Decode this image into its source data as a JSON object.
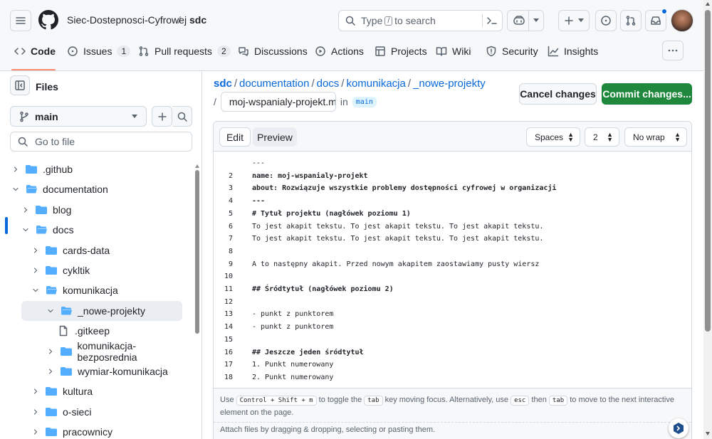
{
  "header": {
    "org": "Siec-Dostepnosci-Cyfrowej",
    "slash": "/",
    "repo": "sdc",
    "search_prefix": "Type",
    "search_key": "/",
    "search_suffix": "to search",
    "notification_dot_color": "#0969da"
  },
  "tabs": [
    {
      "label": "Code",
      "icon": "code-icon"
    },
    {
      "label": "Issues",
      "count": "1",
      "icon": "issue-icon"
    },
    {
      "label": "Pull requests",
      "count": "2",
      "icon": "pull-request-icon"
    },
    {
      "label": "Discussions",
      "icon": "discussion-icon"
    },
    {
      "label": "Actions",
      "icon": "play-icon"
    },
    {
      "label": "Projects",
      "icon": "table-icon"
    },
    {
      "label": "Wiki",
      "icon": "book-icon"
    },
    {
      "label": "Security",
      "icon": "shield-icon"
    },
    {
      "label": "Insights",
      "icon": "graph-icon"
    }
  ],
  "sidebar": {
    "title": "Files",
    "branch": "main",
    "go_to_file_placeholder": "Go to file",
    "tree": [
      {
        "name": ".github",
        "type": "folder",
        "expanded": false,
        "depth": 0
      },
      {
        "name": "documentation",
        "type": "folder",
        "expanded": true,
        "depth": 0
      },
      {
        "name": "blog",
        "type": "folder",
        "expanded": false,
        "depth": 1
      },
      {
        "name": "docs",
        "type": "folder",
        "expanded": true,
        "depth": 1
      },
      {
        "name": "cards-data",
        "type": "folder",
        "expanded": false,
        "depth": 2
      },
      {
        "name": "cykltik",
        "type": "folder",
        "expanded": false,
        "depth": 2
      },
      {
        "name": "komunikacja",
        "type": "folder",
        "expanded": true,
        "depth": 2
      },
      {
        "name": "_nowe-projekty",
        "type": "folder",
        "expanded": true,
        "depth": 3,
        "selected": true
      },
      {
        "name": ".gitkeep",
        "type": "file",
        "depth": 4
      },
      {
        "name": "komunikacja-bezposrednia",
        "type": "folder",
        "expanded": false,
        "depth": 3
      },
      {
        "name": "wymiar-komunikacja",
        "type": "folder",
        "expanded": false,
        "depth": 3
      },
      {
        "name": "kultura",
        "type": "folder",
        "expanded": false,
        "depth": 2
      },
      {
        "name": "o-sieci",
        "type": "folder",
        "expanded": false,
        "depth": 2
      },
      {
        "name": "pracownicy",
        "type": "folder",
        "expanded": false,
        "depth": 2
      }
    ]
  },
  "breadcrumb": {
    "repo": "sdc",
    "parts": [
      "documentation",
      "docs",
      "komunikacja",
      "_nowe-projekty"
    ],
    "sep": "/",
    "filename": "moj-wspanialy-projekt.md",
    "in_label": "in",
    "branch": "main"
  },
  "actions": {
    "cancel": "Cancel changes",
    "commit": "Commit changes..."
  },
  "editor": {
    "tab_edit": "Edit",
    "tab_preview": "Preview",
    "indent_mode": "Spaces",
    "indent_size": "2",
    "wrap_mode": "No wrap",
    "lines": [
      {
        "n": "",
        "text": "---",
        "bold": false
      },
      {
        "n": "2",
        "text": "name: moj-wspanialy-projekt",
        "bold": true
      },
      {
        "n": "3",
        "text": "about: Rozwiązuje wszystkie problemy dostępności cyfrowej w organizacji",
        "bold": true
      },
      {
        "n": "4",
        "text": "---",
        "bold": true
      },
      {
        "n": "5",
        "text": "# Tytuł projektu (nagłówek poziomu 1)",
        "bold": true
      },
      {
        "n": "6",
        "text": "To jest akapit tekstu. To jest akapit tekstu. To jest akapit tekstu.",
        "bold": false
      },
      {
        "n": "7",
        "text": "To jest akapit tekstu. To jest akapit tekstu. To jest akapit tekstu.",
        "bold": false
      },
      {
        "n": "8",
        "text": "",
        "bold": false
      },
      {
        "n": "9",
        "text": "A to następny akapit. Przed nowym akapitem zaostawiamy pusty wiersz",
        "bold": false
      },
      {
        "n": "10",
        "text": "",
        "bold": false
      },
      {
        "n": "11",
        "text": "## Śródtytuł (nagłówek poziomu 2)",
        "bold": true
      },
      {
        "n": "12",
        "text": "",
        "bold": false
      },
      {
        "n": "13",
        "text": "- punkt z punktorem",
        "bold": false
      },
      {
        "n": "14",
        "text": "- punkt z punktorem",
        "bold": false
      },
      {
        "n": "15",
        "text": "",
        "bold": false
      },
      {
        "n": "16",
        "text": "## Jeszcze jeden śródtytuł",
        "bold": true
      },
      {
        "n": "17",
        "text": "1. Punkt numerowany",
        "bold": false
      },
      {
        "n": "18",
        "text": "2. Punkt numerowany",
        "bold": false
      }
    ],
    "help": {
      "use": "Use",
      "keys": "Control + Shift + m",
      "to_toggle": "to toggle the",
      "tab": "tab",
      "key_moving": "key moving focus. Alternatively, use",
      "esc": "esc",
      "then": "then",
      "to_move": "to move to the next interactive element on the page."
    },
    "attach": "Attach files by dragging & dropping, selecting or pasting them."
  }
}
